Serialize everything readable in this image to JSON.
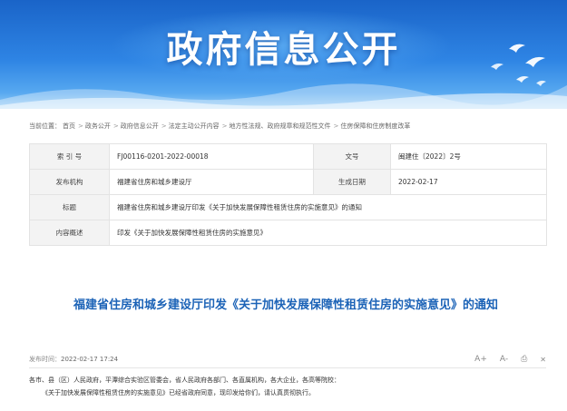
{
  "banner": {
    "title": "政府信息公开"
  },
  "breadcrumb": {
    "prefix": "当前位置：",
    "items": [
      "首页",
      "政务公开",
      "政府信息公开",
      "法定主动公开内容",
      "地方性法规、政府规章和规范性文件",
      "住房保障和住房制度改革"
    ],
    "separator": ">"
  },
  "info": {
    "index_label": "索 引 号",
    "index_value": "FJ00116-0201-2022-00018",
    "docno_label": "文号",
    "docno_value": "闽建住〔2022〕2号",
    "publisher_label": "发布机构",
    "publisher_value": "福建省住房和城乡建设厅",
    "date_label": "生成日期",
    "date_value": "2022-02-17",
    "title_label": "标题",
    "title_value": "福建省住房和城乡建设厅印发《关于加快发展保障性租赁住房的实施意见》的通知",
    "summary_label": "内容概述",
    "summary_value": "印发《关于加快发展保障性租赁住房的实施意见》"
  },
  "article": {
    "title": "福建省住房和城乡建设厅印发《关于加快发展保障性租赁住房的实施意见》的通知",
    "published_label": "发布时间：",
    "published_value": "2022-02-17 17:24",
    "tools": {
      "font_up": "A+",
      "font_down": "A-",
      "print": "⎙",
      "close": "✕"
    },
    "para1": "各市、县（区）人民政府，平潭综合实验区管委会，省人民政府各部门、各直属机构，各大企业，各高等院校：",
    "para2": "《关于加快发展保障性租赁住房的实施意见》已经省政府同意，现印发给你们，请认真贯彻执行。"
  },
  "colors": {
    "banner_blue": "#2e84e4",
    "title_blue": "#1c63b7",
    "label_bg": "#f3f3f3"
  }
}
